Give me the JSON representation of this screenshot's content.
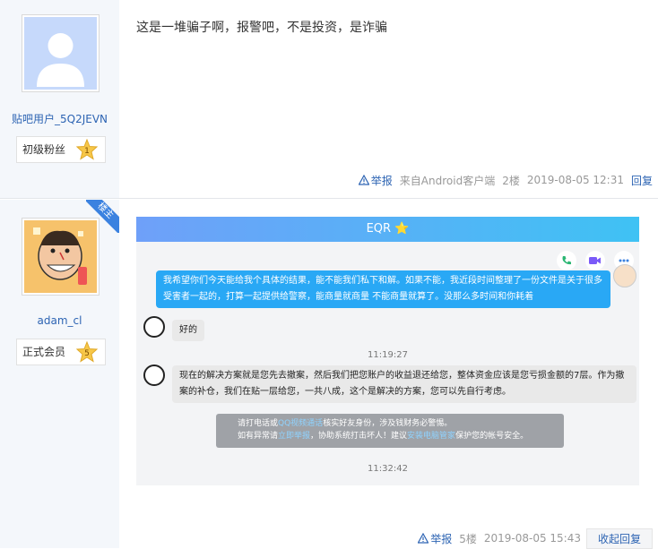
{
  "post1": {
    "username": "贴吧用户_5Q2JEVN",
    "badge_label": "初级粉丝",
    "badge_level": "1",
    "content": "这是一堆骗子啊，报警吧，不是投资，是诈骗",
    "tail": {
      "report": "举报",
      "source": "来自Android客户端",
      "floor": "2楼",
      "time": "2019-08-05 12:31",
      "reply": "回复"
    }
  },
  "post2": {
    "ribbon": "楼主",
    "username": "adam_cl",
    "badge_label": "正式会员",
    "badge_level": "5",
    "chat": {
      "title": "EQR ⭐",
      "msg_user": "我希望你们今天能给我个具体的结果，能不能我们私下和解。如果不能，我近段时间整理了一份文件是关于很多受害者一起的，打算一起提供给警察，能商量就商量 不能商量就算了。没那么多时间和你耗着",
      "msg_bot1": "好的",
      "time1": "11:19:27",
      "msg_bot2": "现在的解决方案就是您先去撤案，然后我们把您账户的收益退还给您，整体资金应该是您亏损金额的7层。作为撤案的补仓，我们在贴一层给您，一共八成，这个是解决的方案，您可以先自行考虑。",
      "notice_line1_a": "请打电话或",
      "notice_line1_link": "QQ视频通话",
      "notice_line1_b": "核实好友身份，涉及钱财务必警惕。",
      "notice_line2_a": "如有异常请",
      "notice_line2_link1": "立即举报",
      "notice_line2_b": "，协助系统打击坏人！建议",
      "notice_line2_link2": "安装电脑管家",
      "notice_line2_c": "保护您的帐号安全。",
      "time2": "11:32:42"
    },
    "tail": {
      "report": "举报",
      "floor": "5楼",
      "time": "2019-08-05 15:43",
      "collapse": "收起回复"
    }
  }
}
